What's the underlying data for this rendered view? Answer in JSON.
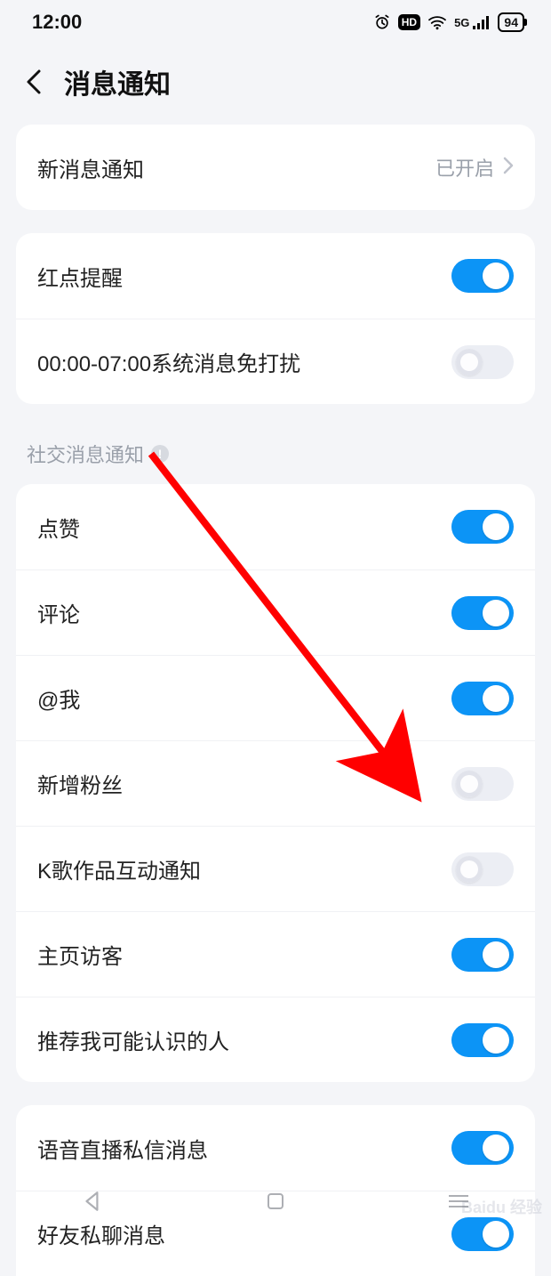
{
  "status": {
    "time": "12:00",
    "hd": "HD",
    "network": "5G",
    "battery": "94"
  },
  "header": {
    "title": "消息通知"
  },
  "group1": {
    "new_message": {
      "label": "新消息通知",
      "value": "已开启"
    },
    "red_dot": {
      "label": "红点提醒",
      "on": true
    },
    "dnd": {
      "label": "00:00-07:00系统消息免打扰",
      "on": false
    }
  },
  "section": {
    "title": "社交消息通知"
  },
  "group2": {
    "like": {
      "label": "点赞",
      "on": true
    },
    "comment": {
      "label": "评论",
      "on": true
    },
    "at_me": {
      "label": "@我",
      "on": true
    },
    "new_fans": {
      "label": "新增粉丝",
      "on": false
    },
    "ksong": {
      "label": "K歌作品互动通知",
      "on": false
    },
    "visitors": {
      "label": "主页访客",
      "on": true
    },
    "recommend": {
      "label": "推荐我可能认识的人",
      "on": true
    }
  },
  "group3": {
    "voice_dm": {
      "label": "语音直播私信消息",
      "on": true
    },
    "friend_chat": {
      "label": "好友私聊消息",
      "on": true
    }
  },
  "watermark": {
    "brand": "Baidu 经验"
  },
  "annotation": {
    "arrow_color": "#ff0000"
  }
}
